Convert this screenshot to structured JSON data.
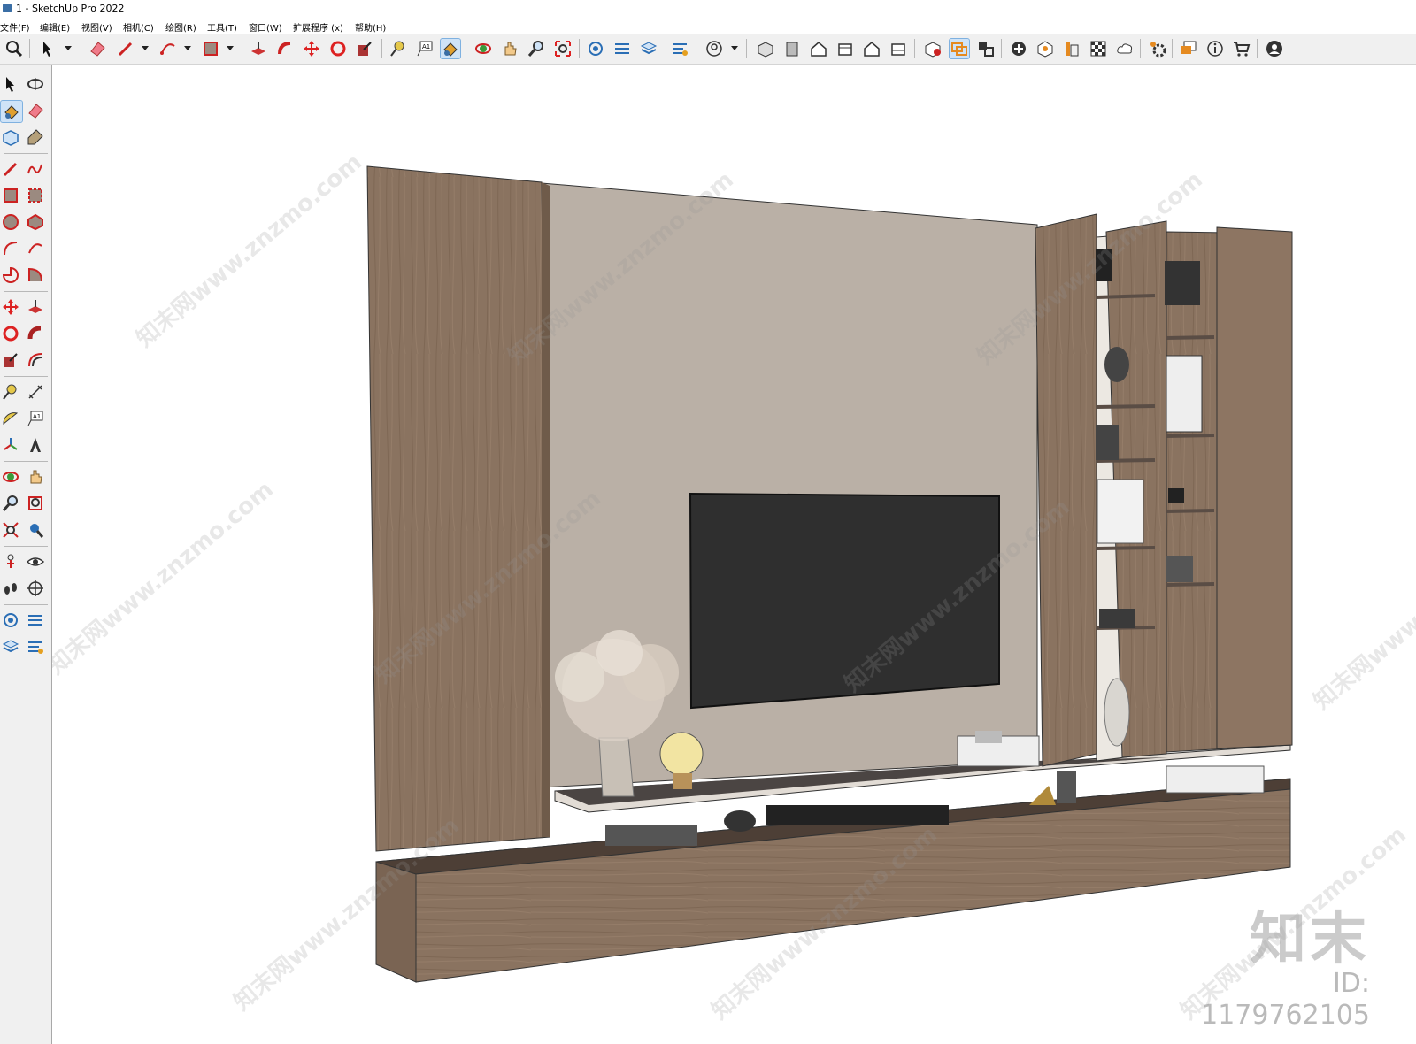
{
  "window": {
    "title": "1 - SketchUp Pro 2022"
  },
  "menu": [
    "文件(F)",
    "编辑(E)",
    "视图(V)",
    "相机(C)",
    "绘图(R)",
    "工具(T)",
    "窗口(W)",
    "扩展程序 (x)",
    "帮助(H)"
  ],
  "toolbar": {
    "icons": [
      "search-icon",
      "select-icon",
      "eraser-icon",
      "pencil-icon",
      "arc-icon",
      "rectangle-icon",
      "push-pull-icon",
      "follow-me-icon",
      "move-icon",
      "rotate-icon",
      "scale-icon",
      "tape-measure-icon",
      "text-icon",
      "paint-bucket-icon",
      "orbit-icon",
      "pan-icon",
      "zoom-icon",
      "zoom-extents-icon",
      "component-options-icon",
      "component-attributes-icon",
      "layers-icon",
      "outliner-icon",
      "account-icon",
      "iso-view-icon",
      "top-view-icon",
      "front-view-icon",
      "right-view-icon",
      "back-view-icon",
      "left-view-icon",
      "warehouse-icon",
      "section-plane-icon",
      "section-display-icon",
      "add-location-icon",
      "sandbox-icon",
      "style-icon",
      "material-icon",
      "cloud-icon",
      "settings-icon",
      "message-icon",
      "info-icon",
      "cart-icon",
      "user-icon"
    ],
    "active": "paint-bucket-icon"
  },
  "left_toolbar": {
    "icons": [
      "select-icon",
      "orbit-icon",
      "paint-bucket-icon",
      "eraser-icon",
      "component-icon",
      "tag-icon",
      "line-icon",
      "freehand-icon",
      "rectangle-icon",
      "rotated-rectangle-icon",
      "circle-icon",
      "polygon-icon",
      "arc-icon",
      "three-point-arc-icon",
      "pie-icon",
      "two-point-arc-icon",
      "move-icon",
      "push-pull-icon",
      "rotate-icon",
      "follow-me-icon",
      "scale-icon",
      "offset-icon",
      "tape-measure-icon",
      "dimension-icon",
      "protractor-icon",
      "text-icon",
      "axes-icon",
      "3d-text-icon",
      "orbit-tool-icon",
      "pan-tool-icon",
      "zoom-tool-icon",
      "zoom-window-icon",
      "zoom-extents-tool-icon",
      "previous-view-icon",
      "position-camera-icon",
      "look-around-icon",
      "walk-icon",
      "section-plane-tool-icon",
      "layer-settings-icon",
      "layer-filter-icon",
      "layer-stack-icon",
      "layer-config-icon"
    ],
    "active": "paint-bucket-icon"
  },
  "viewport": {
    "watermark_text": "知末网www.znzmo.com",
    "brand_logo": "知末",
    "brand_id": "ID: 1179762105"
  },
  "colors": {
    "wood": "#8a7360",
    "wall": "#bab0a6",
    "tv": "#2d2d2d",
    "shelf": "#5a4d45"
  }
}
